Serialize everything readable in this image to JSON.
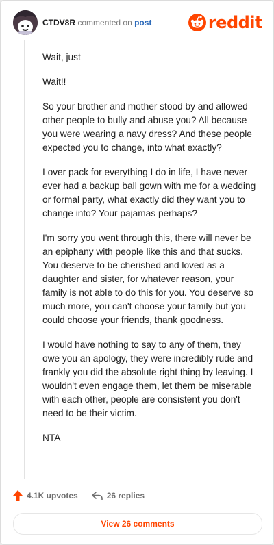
{
  "header": {
    "username": "CTDV8R",
    "commented_on": "commented on",
    "post_link": "post",
    "logo_text": "reddit"
  },
  "comment": {
    "paragraphs": [
      "Wait, just",
      "Wait!!",
      "So your brother and mother stood by and allowed other people to bully and abuse you? All because you were wearing a navy dress? And these people expected you to change, into what exactly?",
      "I over pack for everything I do in life, I have never ever had a backup ball gown with me for a wedding or formal party, what exactly did they want you to change into? Your pajamas perhaps?",
      "I'm sorry you went through this, there will never be an epiphany with people like this and that sucks. You deserve to be cherished and loved as a daughter and sister, for whatever reason, your family is not able to do this for you. You deserve so much more, you can't choose your family but you could choose your friends, thank goodness.",
      "I would have nothing to say to any of them, they owe you an apology, they were incredibly rude and frankly you did the absolute right thing by leaving. I wouldn't even engage them, let them be miserable with each other, people are consistent you don't need to be their victim.",
      "NTA"
    ]
  },
  "actions": {
    "upvotes": "4.1K upvotes",
    "replies": "26 replies",
    "upvote_icon": "upvote-arrow-icon",
    "reply_icon": "reply-arrow-icon"
  },
  "footer": {
    "view_comments": "View 26 comments"
  },
  "colors": {
    "brand": "#ff4500",
    "link": "#2a68b8",
    "text": "#222222"
  }
}
